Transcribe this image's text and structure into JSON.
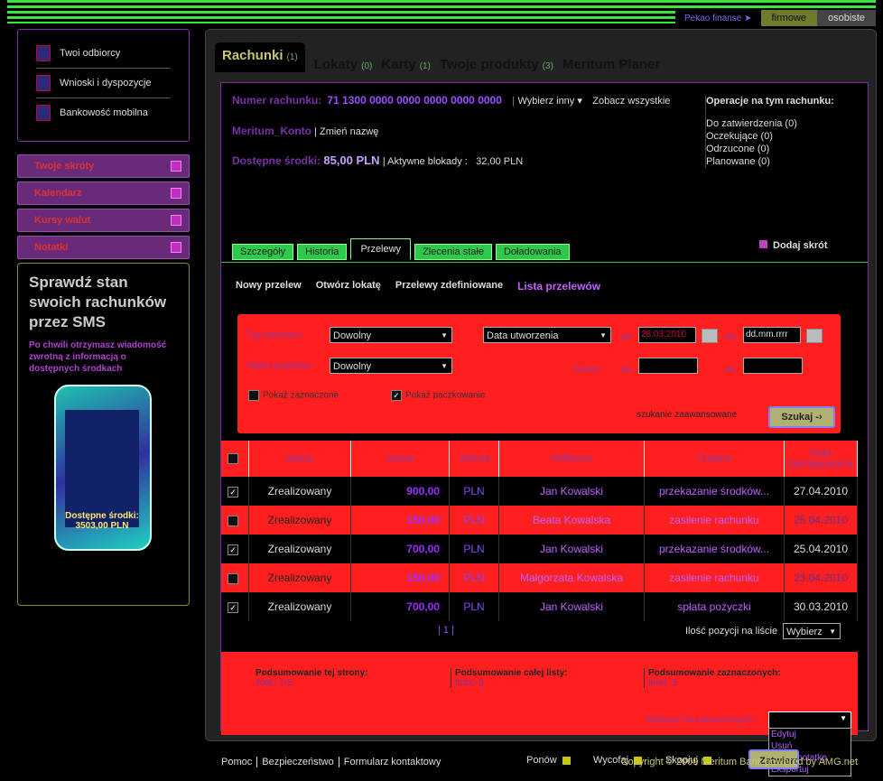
{
  "topnav": {
    "link": "Pekao finanse ➤",
    "tab_business": "firmowe",
    "tab_personal": "osobiste"
  },
  "sidebar": {
    "menu": [
      {
        "label": "Twoi odbiorcy",
        "icon": "user-icon"
      },
      {
        "label": "Wnioski i dyspozycje",
        "icon": "document-icon"
      },
      {
        "label": "Bankowość mobilna",
        "icon": "mobile-icon"
      }
    ],
    "collapsibles": [
      "Twoje skróty",
      "Kalendarz",
      "Kursy walut",
      "Notatki"
    ],
    "promo": {
      "title": "Sprawdź stan swoich rachunków przez SMS",
      "text": "Po chwili otrzymasz wiadomość zwrotną z informacją o dostępnych środkach",
      "phone_balance_label": "Dostępne środki:",
      "phone_balance_value": "3503,00 PLN"
    }
  },
  "product_tabs": [
    {
      "label": "Rachunki",
      "count": "(1)"
    },
    {
      "label": "Lokaty",
      "count": "(0)"
    },
    {
      "label": "Karty",
      "count": "(1)"
    },
    {
      "label": "Twoje produkty",
      "count": "(3)"
    },
    {
      "label": "Meritum Planer",
      "count": ""
    }
  ],
  "account": {
    "number_label": "Numer rachunku:",
    "number": "71 1300 0000 0000 0000 0000 0000",
    "choose_other": "Wybierz inny ▾",
    "see_all": "Zobacz wszystkie",
    "name": "Meritum_Konto",
    "rename": "Zmień nazwę",
    "available_label": "Dostępne środki:",
    "available_value": "85,00 PLN",
    "blocks_label": "Aktywne blokady :",
    "blocks_value": "32,00 PLN"
  },
  "operations": {
    "title": "Operacje na tym rachunku:",
    "items": [
      "Do zatwierdzenia (0)",
      "Oczekujące (0)",
      "Odrzucone (0)",
      "Planowane (0)"
    ]
  },
  "sub_tabs": [
    "Szczegóły",
    "Historia",
    "Przelewy",
    "Zlecenia stałe",
    "Doładowania"
  ],
  "add_shortcut": "Dodaj skrót",
  "transfer_nav": [
    "Nowy przelew",
    "Otwórz lokatę",
    "Przelewy zdefiniowane",
    "Lista przelewów"
  ],
  "filter": {
    "type_label": "Typ przelewu:",
    "type_value": "Dowolny",
    "date_type": "Data utworzenia",
    "from_label": "od:",
    "from_value": "28.03.2010",
    "to_label": "do:",
    "to_value": "dd.mm.rrrr",
    "status_label": "Status przelewu:",
    "status_value": "Dowolny",
    "amount_label": "Kwota:",
    "amount_from": "od:",
    "amount_to": "do:",
    "show_marked": "Pokaż zaznaczone",
    "show_package": "Pokaż paczkowanie",
    "advanced": "szukanie zaawansowane",
    "search_button": "Szukaj -›"
  },
  "table": {
    "headers": [
      "Status",
      "Kwota",
      "Waluta",
      "Odbiorca",
      "Tytułem",
      "Data zaksięgowania"
    ],
    "rows": [
      {
        "status": "Zrealizowany",
        "amount": "900,00",
        "currency": "PLN",
        "recipient": "Jan Kowalski",
        "title": "przekazanie środków...",
        "date": "27.04.2010",
        "checked": true
      },
      {
        "status": "Zrealizowany",
        "amount": "150,00",
        "currency": "PLN",
        "recipient": "Beata Kowalska",
        "title": "zasilenie rachunku",
        "date": "25.04.2010",
        "checked": false
      },
      {
        "status": "Zrealizowany",
        "amount": "700,00",
        "currency": "PLN",
        "recipient": "Jan Kowalski",
        "title": "przekazanie środków...",
        "date": "25.04.2010",
        "checked": true
      },
      {
        "status": "Zrealizowany",
        "amount": "150,00",
        "currency": "PLN",
        "recipient": "Małgorzata Kowalska",
        "title": "zasilenie rachunku",
        "date": "23.04.2010",
        "checked": false
      },
      {
        "status": "Zrealizowany",
        "amount": "700,00",
        "currency": "PLN",
        "recipient": "Jan Kowalski",
        "title": "spłata pożyczki",
        "date": "30.03.2010",
        "checked": true
      }
    ]
  },
  "pager": {
    "pages": "| 1 |",
    "per_page_label": "Ilość pozycji na liście",
    "per_page_value": "Wybierz"
  },
  "summary": {
    "page_title": "Podsumowanie tej strony:",
    "page_count": "Ilość: 1-5",
    "list_title": "Podsumowanie całej listy:",
    "list_count": "Ilość: 5",
    "marked_title": "Podsumowanie zaznaczonych:",
    "marked_count": "Ilość: 3",
    "execute_label": "Wykonaj na zaznaczonych",
    "execute_options": [
      "Edytuj",
      "Usuń",
      "Dodaj notatkę",
      "Eksportuj"
    ]
  },
  "actions": {
    "repeat": "Ponów",
    "withdraw": "Wycofaj",
    "copy": "Skopiuj",
    "approve": "Zatwierdź"
  },
  "footer": {
    "links": [
      "Pomoc",
      "Bezpieczeństwo",
      "Formularz kontaktowy"
    ],
    "copyright": "Copyright © 2009 Meritum Bank powered by AMG.net"
  }
}
